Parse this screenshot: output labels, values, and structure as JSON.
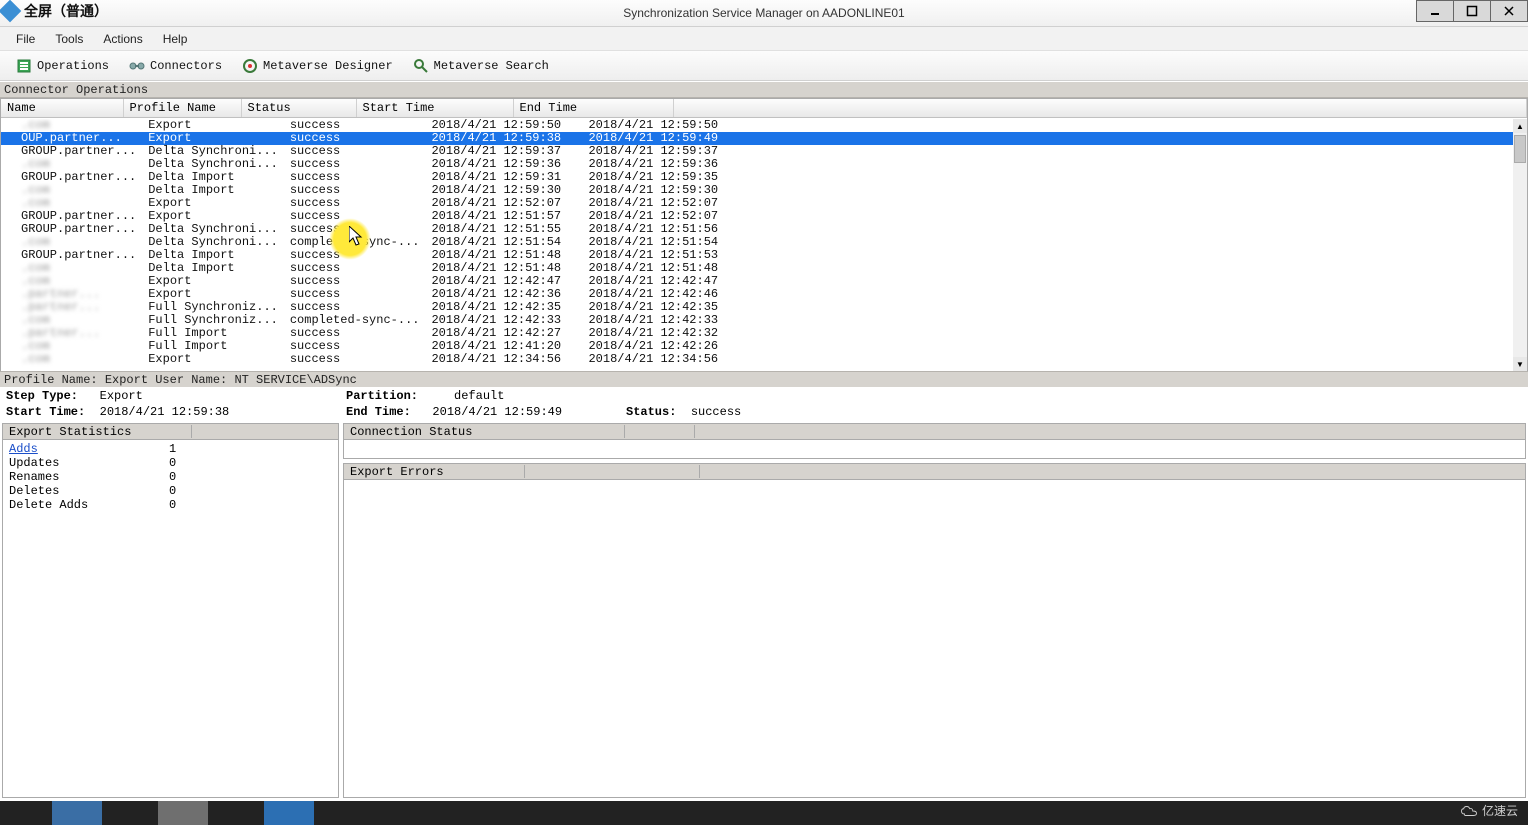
{
  "recorder_label": "全屏（普通）",
  "window_title": "Synchronization Service Manager on AADONLINE01",
  "menu": [
    "File",
    "Tools",
    "Actions",
    "Help"
  ],
  "toolbar": {
    "operations": "Operations",
    "connectors": "Connectors",
    "mv_designer": "Metaverse Designer",
    "mv_search": "Metaverse Search"
  },
  "grid_title": "Connector Operations",
  "columns": {
    "name": "Name",
    "profile": "Profile Name",
    "status": "Status",
    "start": "Start Time",
    "end": "End Time"
  },
  "rows": [
    {
      "name": ".com",
      "profile": "Export",
      "status": "success",
      "start": "2018/4/21 12:59:50",
      "end": "2018/4/21 12:59:50",
      "blur": true
    },
    {
      "name": "OUP.partner...",
      "profile": "Export",
      "status": "success",
      "start": "2018/4/21 12:59:38",
      "end": "2018/4/21 12:59:49",
      "selected": true
    },
    {
      "name": "GROUP.partner...",
      "profile": "Delta Synchroni...",
      "status": "success",
      "start": "2018/4/21 12:59:37",
      "end": "2018/4/21 12:59:37"
    },
    {
      "name": ".com",
      "profile": "Delta Synchroni...",
      "status": "success",
      "start": "2018/4/21 12:59:36",
      "end": "2018/4/21 12:59:36",
      "blur": true
    },
    {
      "name": "GROUP.partner...",
      "profile": "Delta Import",
      "status": "success",
      "start": "2018/4/21 12:59:31",
      "end": "2018/4/21 12:59:35"
    },
    {
      "name": ".com",
      "profile": "Delta Import",
      "status": "success",
      "start": "2018/4/21 12:59:30",
      "end": "2018/4/21 12:59:30",
      "blur": true
    },
    {
      "name": ".com",
      "profile": "Export",
      "status": "success",
      "start": "2018/4/21 12:52:07",
      "end": "2018/4/21 12:52:07",
      "blur": true
    },
    {
      "name": "GROUP.partner...",
      "profile": "Export",
      "status": "success",
      "start": "2018/4/21 12:51:57",
      "end": "2018/4/21 12:52:07"
    },
    {
      "name": "GROUP.partner...",
      "profile": "Delta Synchroni...",
      "status": "success",
      "start": "2018/4/21 12:51:55",
      "end": "2018/4/21 12:51:56"
    },
    {
      "name": ".com",
      "profile": "Delta Synchroni...",
      "status": "completed-sync-...",
      "start": "2018/4/21 12:51:54",
      "end": "2018/4/21 12:51:54",
      "blur": true
    },
    {
      "name": "GROUP.partner...",
      "profile": "Delta Import",
      "status": "success",
      "start": "2018/4/21 12:51:48",
      "end": "2018/4/21 12:51:53"
    },
    {
      "name": ".com",
      "profile": "Delta Import",
      "status": "success",
      "start": "2018/4/21 12:51:48",
      "end": "2018/4/21 12:51:48",
      "blur": true
    },
    {
      "name": ".com",
      "profile": "Export",
      "status": "success",
      "start": "2018/4/21 12:42:47",
      "end": "2018/4/21 12:42:47",
      "blur": true
    },
    {
      "name": ".partner...",
      "profile": "Export",
      "status": "success",
      "start": "2018/4/21 12:42:36",
      "end": "2018/4/21 12:42:46",
      "blur": true
    },
    {
      "name": ".partner...",
      "profile": "Full Synchroniz...",
      "status": "success",
      "start": "2018/4/21 12:42:35",
      "end": "2018/4/21 12:42:35",
      "blur": true
    },
    {
      "name": ".com",
      "profile": "Full Synchroniz...",
      "status": "completed-sync-...",
      "start": "2018/4/21 12:42:33",
      "end": "2018/4/21 12:42:33",
      "blur": true
    },
    {
      "name": ".partner...",
      "profile": "Full Import",
      "status": "success",
      "start": "2018/4/21 12:42:27",
      "end": "2018/4/21 12:42:32",
      "blur": true
    },
    {
      "name": ".com",
      "profile": "Full Import",
      "status": "success",
      "start": "2018/4/21 12:41:20",
      "end": "2018/4/21 12:42:26",
      "blur": true
    },
    {
      "name": ".com",
      "profile": "Export",
      "status": "success",
      "start": "2018/4/21 12:34:56",
      "end": "2018/4/21 12:34:56",
      "blur": true
    }
  ],
  "details": {
    "profile_line": "Profile Name: Export   User Name: NT SERVICE\\ADSync",
    "step_type_label": "Step Type:",
    "step_type_value": "Export",
    "start_label": "Start Time:",
    "start_value": "2018/4/21 12:59:38",
    "partition_label": "Partition:",
    "partition_value": "default",
    "end_label": "End Time:",
    "end_value": "2018/4/21 12:59:49",
    "status_label": "Status:",
    "status_value": "success"
  },
  "panes": {
    "export_stats": "Export Statistics",
    "connection_status": "Connection Status",
    "export_errors": "Export Errors"
  },
  "stats": [
    {
      "k": "Adds",
      "v": "1",
      "link": true
    },
    {
      "k": "Updates",
      "v": "0"
    },
    {
      "k": "Renames",
      "v": "0"
    },
    {
      "k": "Deletes",
      "v": "0"
    },
    {
      "k": "Delete Adds",
      "v": "0"
    }
  ],
  "watermark": "亿速云"
}
